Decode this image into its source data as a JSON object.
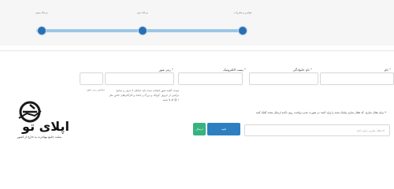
{
  "steps": [
    {
      "label": "مرحله سوم"
    },
    {
      "label": "مرحله دوم"
    },
    {
      "label": "قوانین و مقررات"
    }
  ],
  "form": {
    "first_name": {
      "label": "نام"
    },
    "last_name": {
      "label": "نام خانوادگی"
    },
    "email": {
      "label": "پست الکترونیک"
    },
    "password": {
      "label": "رمز عبور",
      "help": "توجه: کلمه عبور انتخاب شده باید حداقل ۸ حرف و شامل ترکیبی از حروف کوچک و بزرگ و اعداد و کاراکترهای خاص مثل ! @ # $ باشد",
      "hint": "نمایش رمز عبور"
    }
  },
  "verification": {
    "note": "* برای فعال سازی، کد فعال سازی پیامک شده را وارد کنید؛ در صورت عدم دریافت، روی دکمه ارسال مجدد کلیک کنید",
    "placeholder": "کد فعال سازی را وارد کنید",
    "confirm_label": "تایید",
    "resend_label": "ارسال"
  },
  "logo": {
    "brand": "اپلای تو",
    "tagline": "سایت جامع مهاجرت به خارج از کشور"
  },
  "colors": {
    "accent": "#2a6fb3",
    "progress": "#9cc7e6",
    "success": "#36b37e"
  }
}
